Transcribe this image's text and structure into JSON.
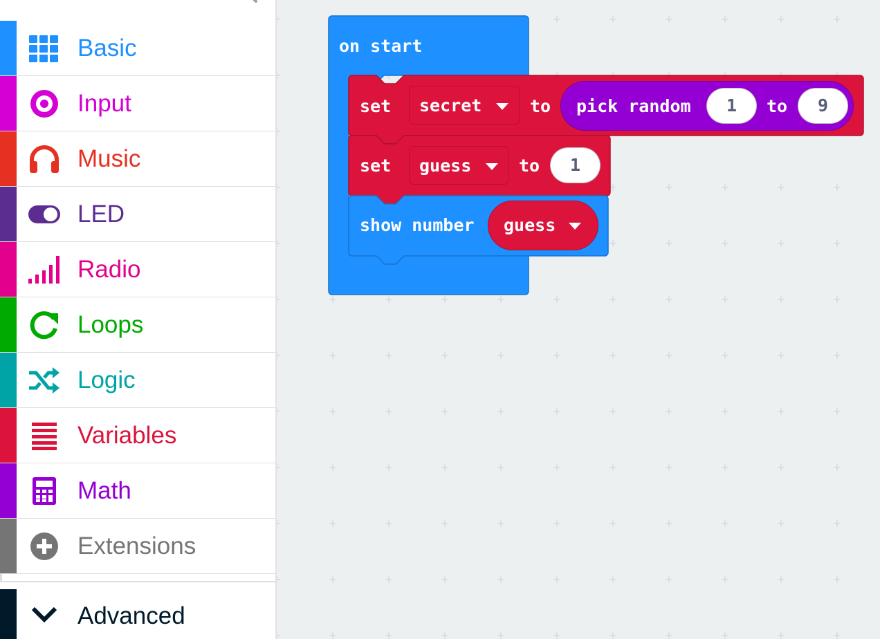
{
  "toolbox": {
    "categories": [
      {
        "label": "Basic",
        "color": "#1e90ff",
        "icon": "grid-icon"
      },
      {
        "label": "Input",
        "color": "#d400d4",
        "icon": "radio-button-icon"
      },
      {
        "label": "Music",
        "color": "#e63022",
        "icon": "headphones-icon"
      },
      {
        "label": "LED",
        "color": "#5c2d91",
        "icon": "toggle-icon"
      },
      {
        "label": "Radio",
        "color": "#e3008c",
        "icon": "signal-bars-icon"
      },
      {
        "label": "Loops",
        "color": "#00aa00",
        "icon": "refresh-icon"
      },
      {
        "label": "Logic",
        "color": "#00a4a6",
        "icon": "shuffle-icon"
      },
      {
        "label": "Variables",
        "color": "#dc143c",
        "icon": "list-lines-icon"
      },
      {
        "label": "Math",
        "color": "#9400d3",
        "icon": "calculator-icon"
      },
      {
        "label": "Extensions",
        "color": "#757575",
        "icon": "plus-circle-icon"
      }
    ],
    "advanced": {
      "label": "Advanced",
      "color": "#001a2a",
      "icon": "chevron-down-icon"
    }
  },
  "blocks": {
    "on_start": {
      "label": "on start",
      "color": "#1e90ff"
    },
    "set_secret": {
      "set_label": "set",
      "variable": "secret",
      "to_label": "to",
      "color": "#dc143c",
      "pick_random": {
        "label": "pick random",
        "from": "1",
        "to_label": "to",
        "to": "9",
        "color": "#9400d3"
      }
    },
    "set_guess": {
      "set_label": "set",
      "variable": "guess",
      "to_label": "to",
      "value": "1",
      "color": "#dc143c"
    },
    "show_number": {
      "label": "show number",
      "variable": "guess",
      "color": "#1e90ff"
    }
  }
}
